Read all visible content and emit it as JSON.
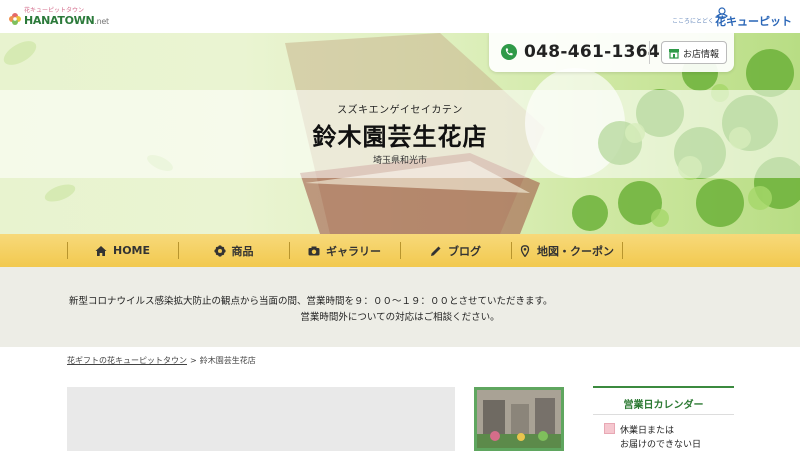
{
  "header": {
    "logo_left": {
      "tagline": "花キューピットタウン",
      "brand": "HANATOWN",
      "suffix": ".net"
    },
    "logo_right": {
      "tagline": "こころにとどく",
      "name": "花キューピット"
    }
  },
  "contact": {
    "phone": "048-461-1364",
    "store_info_label": "お店情報",
    "phone_icon": "phone-icon",
    "store_icon": "shop-icon"
  },
  "hero": {
    "kana": "スズキエンゲイセイカテン",
    "title": "鈴木園芸生花店",
    "city": "埼玉県和光市"
  },
  "nav": {
    "items": [
      {
        "label": "HOME",
        "icon": "home-icon"
      },
      {
        "label": "商品",
        "icon": "flower-icon"
      },
      {
        "label": "ギャラリー",
        "icon": "camera-icon"
      },
      {
        "label": "ブログ",
        "icon": "pencil-icon"
      },
      {
        "label": "地図・クーポン",
        "icon": "map-pin-icon"
      }
    ]
  },
  "notice": {
    "line1": "新型コロナウイルス感染拡大防止の観点から当面の間、営業時間を９：００〜１９：００とさせていただきます。",
    "line2": "営業時間外についての対応はご相談ください。"
  },
  "breadcrumb": {
    "home": "花ギフトの花キューピットタウン",
    "separator": ">",
    "current": "鈴木園芸生花店"
  },
  "calendar": {
    "title": "営業日カレンダー",
    "legend_line1": "休業日または",
    "legend_line2": "お届けのできない日"
  },
  "colors": {
    "nav_bg": "#f2c94f",
    "accent_green": "#2c7a33",
    "notice_bg": "#edede6",
    "holiday_swatch": "#f5c7cf"
  }
}
